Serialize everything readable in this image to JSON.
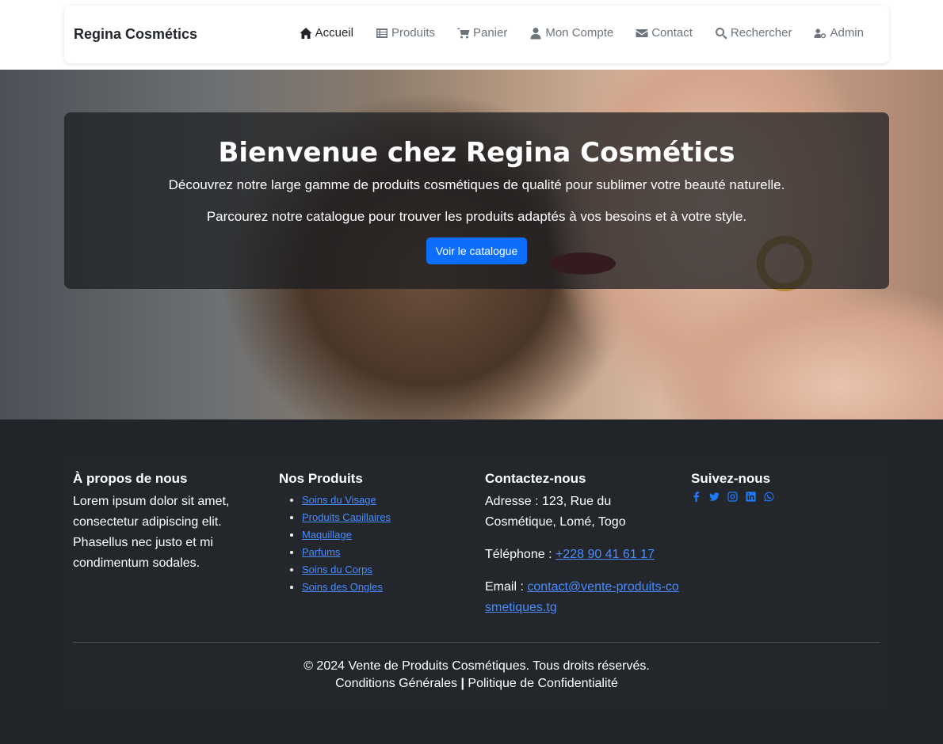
{
  "header": {
    "brand": "Regina Cosmétics",
    "nav": [
      {
        "label": "Accueil",
        "icon": "home-icon",
        "active": true
      },
      {
        "label": "Produits",
        "icon": "list-icon"
      },
      {
        "label": "Panier",
        "icon": "cart-icon"
      },
      {
        "label": "Mon Compte",
        "icon": "user-icon"
      },
      {
        "label": "Contact",
        "icon": "envelope-icon"
      },
      {
        "label": "Rechercher",
        "icon": "search-icon"
      },
      {
        "label": "Admin",
        "icon": "user-gear-icon"
      }
    ]
  },
  "hero": {
    "title": "Bienvenue chez Regina Cosmétics",
    "line1": "Découvrez notre large gamme de produits cosmétiques de qualité pour sublimer votre beauté naturelle.",
    "line2": "Parcourez notre catalogue pour trouver les produits adaptés à vos besoins et à votre style.",
    "button": "Voir le catalogue"
  },
  "footer": {
    "about": {
      "title": "À propos de nous",
      "text": "Lorem ipsum dolor sit amet, consectetur adipiscing elit. Phasellus nec justo et mi condimentum sodales."
    },
    "products": {
      "title": "Nos Produits",
      "items": [
        "Soins du Visage",
        "Produits Capillaires",
        "Maquillage",
        "Parfums",
        "Soins du Corps",
        "Soins des Ongles"
      ]
    },
    "contact": {
      "title": "Contactez-nous",
      "address": "Adresse : 123, Rue du Cosmétique, Lomé, Togo",
      "phone_label": "Téléphone : ",
      "phone": "+228 90 41 61 17",
      "email_label": "Email : ",
      "email": "contact@vente-produits-cosmetiques.tg"
    },
    "social": {
      "title": "Suivez-nous",
      "icons": [
        "facebook-icon",
        "twitter-icon",
        "instagram-icon",
        "linkedin-icon",
        "whatsapp-icon"
      ]
    },
    "copyright": "© 2024 Vente de Produits Cosmétiques. Tous droits réservés.",
    "terms": "Conditions Générales",
    "separator": "|",
    "privacy": "Politique de Confidentialité"
  }
}
